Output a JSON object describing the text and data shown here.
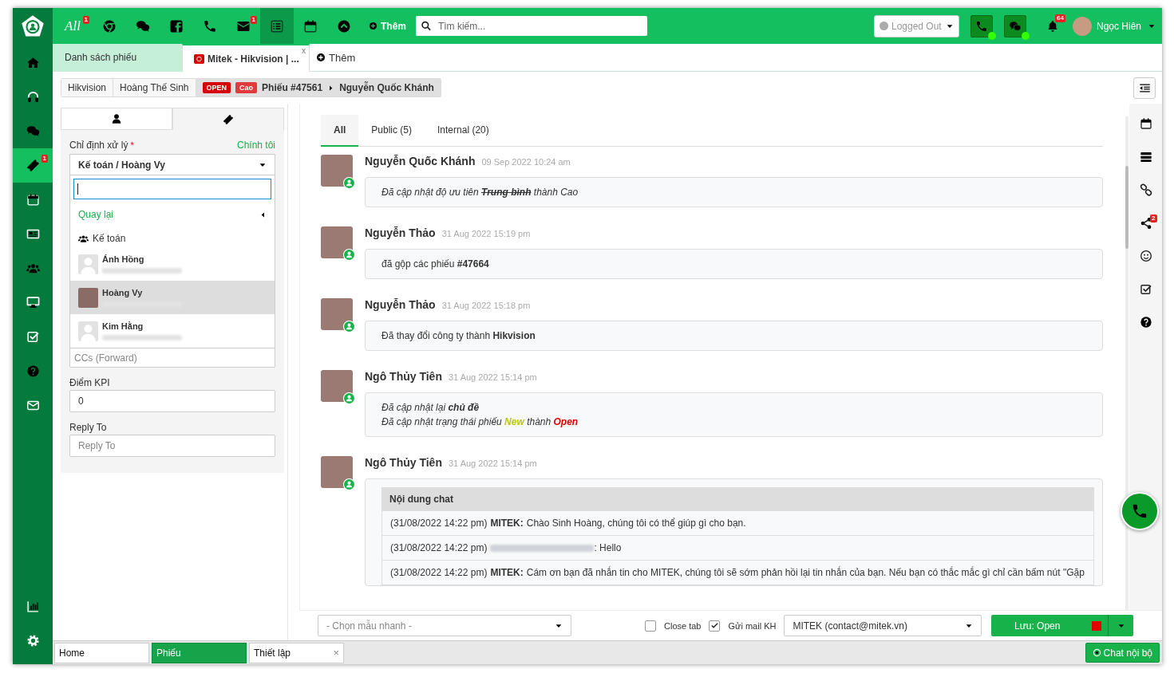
{
  "sidebar": {
    "items": [
      {
        "kind": "home",
        "selected": false
      },
      {
        "kind": "headset",
        "selected": false
      },
      {
        "kind": "chat",
        "selected": false
      },
      {
        "kind": "ticket",
        "selected": true,
        "badge": "1"
      },
      {
        "kind": "calendar",
        "selected": false
      },
      {
        "kind": "news",
        "selected": false
      },
      {
        "kind": "users",
        "selected": false
      },
      {
        "kind": "desktop",
        "selected": false
      },
      {
        "kind": "checkbox",
        "selected": false
      },
      {
        "kind": "question",
        "selected": false
      },
      {
        "kind": "mail",
        "selected": false
      }
    ],
    "bottom_items": [
      {
        "kind": "chart",
        "selected": false
      },
      {
        "kind": "gear",
        "selected": false
      }
    ]
  },
  "topbar": {
    "items": [
      {
        "kind": "all",
        "label": "All",
        "badge": "1",
        "selected": false
      },
      {
        "kind": "chrome",
        "selected": false
      },
      {
        "kind": "chat",
        "selected": false
      },
      {
        "kind": "facebook",
        "selected": false
      },
      {
        "kind": "phone",
        "selected": false
      },
      {
        "kind": "mail",
        "badge": "1",
        "selected": false
      },
      {
        "kind": "list",
        "selected": true
      },
      {
        "kind": "calendar",
        "selected": false
      },
      {
        "kind": "up",
        "selected": false
      }
    ],
    "add_label": "Thêm",
    "search": {
      "placeholder": "Tìm kiếm..."
    },
    "status": {
      "label": "Logged Out"
    },
    "phone": {
      "online": true
    },
    "wechat": {
      "online": true
    },
    "notifications": {
      "badge": "64"
    },
    "user": {
      "name": "Ngọc Hiên"
    }
  },
  "tabs": [
    {
      "label": "Danh sách phiếu",
      "selected": false
    },
    {
      "label": "Mitek - Hikvision | ...",
      "badge": "O",
      "close": "x",
      "selected": true
    }
  ],
  "tabs_add": "Thêm",
  "breadcrumb": {
    "items": [
      "Hikvision",
      "Hoàng Thế Sinh"
    ],
    "status": "OPEN",
    "priority": "Cao",
    "ticket": "Phiếu #47561",
    "contact": "Nguyễn Quốc Khánh"
  },
  "panel": {
    "tabs": [
      {
        "kind": "user",
        "selected": true
      },
      {
        "kind": "ticket",
        "selected": false
      }
    ],
    "assign": {
      "label": "Chỉ định xử lý",
      "required_mark": "*",
      "link": "Chính tôi",
      "value": "Kế toán / Hoàng Vy",
      "back": "Quay lại",
      "group": "Kế toán",
      "options": [
        {
          "name": "Ánh Hồng",
          "photo": false,
          "selected": false
        },
        {
          "name": "Hoàng Vy",
          "photo": true,
          "selected": true
        },
        {
          "name": "Kim Hằng",
          "photo": false,
          "selected": false
        }
      ]
    },
    "cc": {
      "placeholder": "CCs (Forward)"
    },
    "kpi": {
      "label": "Điểm KPI",
      "value": "0"
    },
    "reply_to": {
      "label": "Reply To",
      "placeholder": "Reply To"
    }
  },
  "conversation": {
    "tabs": [
      {
        "label": "All",
        "selected": true
      },
      {
        "label": "Public (5)",
        "selected": false
      },
      {
        "label": "Internal (20)",
        "selected": false
      }
    ],
    "messages": [
      {
        "author": "Nguyễn Quốc Khánh",
        "time": "09 Sep 2022 10:24 am",
        "online": true,
        "kind": "note",
        "italic": true,
        "lines": [
          [
            {
              "text": "Đã cập nhật độ ưu tiên ",
              "kind": "plain"
            },
            {
              "text": "Trung bình",
              "kind": "strike"
            },
            {
              "text": " thành Cao",
              "kind": "plain"
            }
          ]
        ]
      },
      {
        "author": "Nguyễn Thảo",
        "time": "31 Aug 2022 15:19 pm",
        "online": true,
        "kind": "note",
        "italic": false,
        "lines": [
          [
            {
              "text": "đã gộp các phiếu ",
              "kind": "plain"
            },
            {
              "text": "#47664",
              "kind": "bold"
            }
          ]
        ]
      },
      {
        "author": "Nguyễn Thảo",
        "time": "31 Aug 2022 15:18 pm",
        "online": true,
        "kind": "note",
        "italic": false,
        "lines": [
          [
            {
              "text": "Đã thay đổi công ty thành ",
              "kind": "plain"
            },
            {
              "text": "Hikvision",
              "kind": "bold"
            }
          ]
        ]
      },
      {
        "author": "Ngô Thủy Tiên",
        "time": "31 Aug 2022 15:14 pm",
        "online": true,
        "kind": "note",
        "italic": true,
        "lines": [
          [
            {
              "text": "Đã cập nhật lại ",
              "kind": "plain"
            },
            {
              "text": "chủ đề",
              "kind": "bold"
            }
          ],
          [
            {
              "text": "Đã cập nhật trạng thái phiếu ",
              "kind": "plain"
            },
            {
              "text": "New",
              "kind": "status",
              "color": "#bcc800"
            },
            {
              "text": " thành ",
              "kind": "plain"
            },
            {
              "text": "Open",
              "kind": "status",
              "color": "#e00000"
            }
          ]
        ]
      },
      {
        "author": "Ngô Thủy Tiên",
        "time": "31 Aug 2022 15:14 pm",
        "online": true,
        "kind": "chat",
        "title": "Nội dung chat",
        "rows": [
          {
            "time": "(31/08/2022 14:22 pm)",
            "sender": "MITEK:",
            "redacted": false,
            "text": "Chào Sinh Hoàng, chúng tôi có thể giúp gì cho bạn."
          },
          {
            "time": "(31/08/2022 14:22 pm)",
            "redacted": true,
            "text": ": Hello"
          },
          {
            "time": "(31/08/2022 14:22 pm)",
            "sender": "MITEK:",
            "redacted": false,
            "text": "Cám ơn bạn đã nhắn tin cho MITEK, chúng tôi sẽ sớm phản hồi lại tin nhắn của bạn. Nếu bạn có thắc mắc gì chỉ cần bấm nút \"Gặp"
          }
        ]
      }
    ]
  },
  "tools": [
    {
      "kind": "calendar"
    },
    {
      "kind": "server"
    },
    {
      "kind": "link"
    },
    {
      "kind": "share",
      "badge": "2"
    },
    {
      "kind": "smile"
    },
    {
      "kind": "checkbox"
    },
    {
      "kind": "question"
    }
  ],
  "footer": {
    "template": {
      "placeholder": "- Chọn mẫu nhanh -"
    },
    "close_tab": {
      "label": "Close tab",
      "checked": false
    },
    "send_mail": {
      "label": "Gửi mail KH",
      "checked": true
    },
    "sender": "MITEK (contact@mitek.vn)",
    "save": {
      "label": "Lưu: Open",
      "color": "#e00000"
    }
  },
  "taskbar": {
    "items": [
      {
        "label": "Home",
        "selected": false
      },
      {
        "label": "Phiếu",
        "selected": true
      },
      {
        "label": "Thiết lập",
        "close": "×",
        "selected": false
      }
    ],
    "chat_button": "Chat nội bộ"
  }
}
